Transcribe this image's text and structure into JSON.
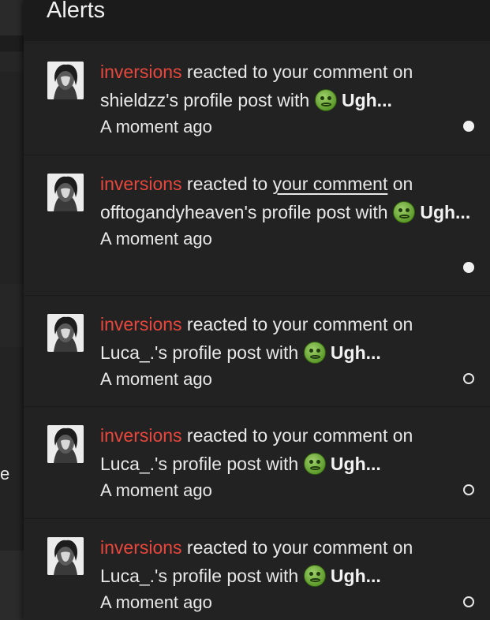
{
  "panel": {
    "title": "Alerts"
  },
  "background": {
    "partial_text": "e"
  },
  "alerts": [
    {
      "user": "inversions",
      "text_before_link": " reacted to ",
      "link_text": "your comment",
      "text_after_link": " on shieldzz's profile post with ",
      "reaction": "Ugh...",
      "time": "A moment ago",
      "status": "unread"
    },
    {
      "user": "inversions",
      "text_before_link": " reacted to ",
      "link_text": "your comment",
      "text_after_link": " on offtogandyheaven's profile post with ",
      "reaction": "Ugh...",
      "time": "A moment ago",
      "status": "unread"
    },
    {
      "user": "inversions",
      "text_before_link": " reacted to ",
      "link_text": "your comment",
      "text_after_link": " on Luca_.'s profile post with ",
      "reaction": "Ugh...",
      "time": "A moment ago",
      "status": "read"
    },
    {
      "user": "inversions",
      "text_before_link": " reacted to ",
      "link_text": "your comment",
      "text_after_link": " on Luca_.'s profile post with ",
      "reaction": "Ugh...",
      "time": "A moment ago",
      "status": "read"
    },
    {
      "user": "inversions",
      "text_before_link": " reacted to ",
      "link_text": "your comment",
      "text_after_link": " on Luca_.'s profile post with ",
      "reaction": "Ugh...",
      "time": "A moment ago",
      "status": "read"
    }
  ]
}
